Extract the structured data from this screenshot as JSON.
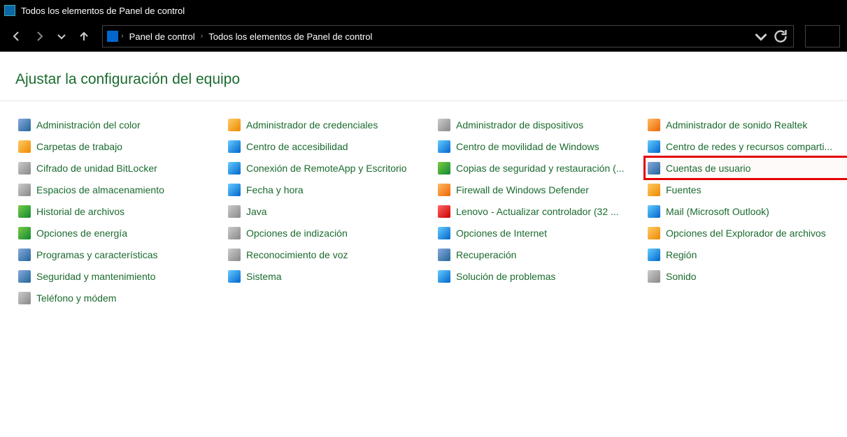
{
  "window": {
    "title": "Todos los elementos de Panel de control"
  },
  "address": {
    "root": "Panel de control",
    "current": "Todos los elementos de Panel de control"
  },
  "heading": "Ajustar la configuración del equipo",
  "columns": [
    [
      {
        "label": "Administración del color",
        "icon": "ic-generic",
        "name": "item-color-management"
      },
      {
        "label": "Carpetas de trabajo",
        "icon": "ic-folder",
        "name": "item-work-folders"
      },
      {
        "label": "Cifrado de unidad BitLocker",
        "icon": "ic-gray",
        "name": "item-bitlocker"
      },
      {
        "label": "Espacios de almacenamiento",
        "icon": "ic-gray",
        "name": "item-storage-spaces"
      },
      {
        "label": "Historial de archivos",
        "icon": "ic-green",
        "name": "item-file-history"
      },
      {
        "label": "Opciones de energía",
        "icon": "ic-green",
        "name": "item-power-options"
      },
      {
        "label": "Programas y características",
        "icon": "ic-generic",
        "name": "item-programs-features"
      },
      {
        "label": "Seguridad y mantenimiento",
        "icon": "ic-generic",
        "name": "item-security-maintenance"
      },
      {
        "label": "Teléfono y módem",
        "icon": "ic-gray",
        "name": "item-phone-modem"
      }
    ],
    [
      {
        "label": "Administrador de credenciales",
        "icon": "ic-folder",
        "name": "item-credential-manager"
      },
      {
        "label": "Centro de accesibilidad",
        "icon": "ic-blue",
        "name": "item-ease-of-access"
      },
      {
        "label": "Conexión de RemoteApp y Escritorio",
        "icon": "ic-blue",
        "name": "item-remoteapp"
      },
      {
        "label": "Fecha y hora",
        "icon": "ic-blue",
        "name": "item-date-time"
      },
      {
        "label": "Java",
        "icon": "ic-gray",
        "name": "item-java"
      },
      {
        "label": "Opciones de indización",
        "icon": "ic-gray",
        "name": "item-indexing-options"
      },
      {
        "label": "Reconocimiento de voz",
        "icon": "ic-gray",
        "name": "item-speech"
      },
      {
        "label": "Sistema",
        "icon": "ic-blue",
        "name": "item-system"
      }
    ],
    [
      {
        "label": "Administrador de dispositivos",
        "icon": "ic-gray",
        "name": "item-device-manager"
      },
      {
        "label": "Centro de movilidad de Windows",
        "icon": "ic-blue",
        "name": "item-mobility-center"
      },
      {
        "label": "Copias de seguridad y restauración (...",
        "icon": "ic-green",
        "name": "item-backup-restore"
      },
      {
        "label": "Firewall de Windows Defender",
        "icon": "ic-orange",
        "name": "item-firewall"
      },
      {
        "label": "Lenovo - Actualizar controlador (32 ...",
        "icon": "ic-red",
        "name": "item-lenovo-update"
      },
      {
        "label": "Opciones de Internet",
        "icon": "ic-blue",
        "name": "item-internet-options"
      },
      {
        "label": "Recuperación",
        "icon": "ic-generic",
        "name": "item-recovery"
      },
      {
        "label": "Solución de problemas",
        "icon": "ic-blue",
        "name": "item-troubleshooting"
      }
    ],
    [
      {
        "label": "Administrador de sonido Realtek",
        "icon": "ic-orange",
        "name": "item-realtek-audio"
      },
      {
        "label": "Centro de redes y recursos comparti...",
        "icon": "ic-blue",
        "name": "item-network-sharing"
      },
      {
        "label": "Cuentas de usuario",
        "icon": "ic-generic",
        "name": "item-user-accounts",
        "highlight": true
      },
      {
        "label": "Fuentes",
        "icon": "ic-folder",
        "name": "item-fonts"
      },
      {
        "label": "Mail (Microsoft Outlook)",
        "icon": "ic-blue",
        "name": "item-mail-outlook"
      },
      {
        "label": "Opciones del Explorador de archivos",
        "icon": "ic-folder",
        "name": "item-explorer-options"
      },
      {
        "label": "Región",
        "icon": "ic-blue",
        "name": "item-region"
      },
      {
        "label": "Sonido",
        "icon": "ic-gray",
        "name": "item-sound"
      }
    ]
  ]
}
